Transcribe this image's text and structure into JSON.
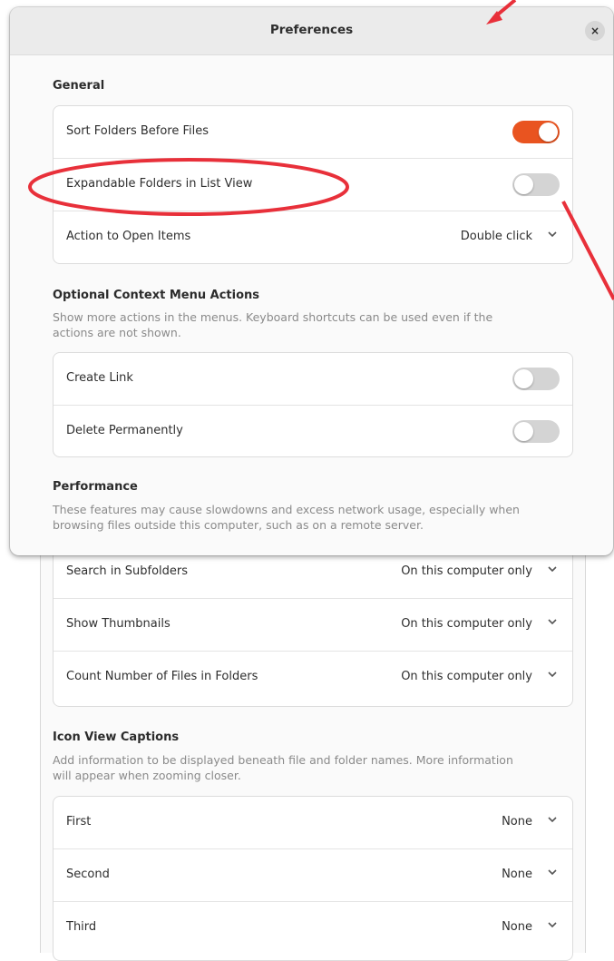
{
  "dialog": {
    "title": "Preferences",
    "close_glyph": "×"
  },
  "general": {
    "title": "General",
    "rows": [
      {
        "label": "Sort Folders Before Files",
        "toggle": true
      },
      {
        "label": "Expandable Folders in List View",
        "toggle": false
      },
      {
        "label": "Action to Open Items",
        "value": "Double click"
      }
    ]
  },
  "context_menu": {
    "title": "Optional Context Menu Actions",
    "description_line1": "Show more actions in the menus. Keyboard shortcuts can be used even if the",
    "description_line2": "actions are not shown.",
    "rows": [
      {
        "label": "Create Link",
        "toggle": false
      },
      {
        "label": "Delete Permanently",
        "toggle": false
      }
    ]
  },
  "performance": {
    "title": "Performance",
    "description_line1": "These features may cause slowdowns and excess network usage, especially when",
    "description_line2": "browsing files outside this computer, such as on a remote server.",
    "rows": [
      {
        "label": "Search in Subfolders",
        "value": "On this computer only"
      },
      {
        "label": "Show Thumbnails",
        "value": "On this computer only"
      },
      {
        "label": "Count Number of Files in Folders",
        "value": "On this computer only"
      }
    ]
  },
  "icon_captions": {
    "title": "Icon View Captions",
    "description_line1": "Add information to be displayed beneath file and folder names. More information",
    "description_line2": "will appear when zooming closer.",
    "rows": [
      {
        "label": "First",
        "value": "None"
      },
      {
        "label": "Second",
        "value": "None"
      },
      {
        "label": "Third",
        "value": "None"
      }
    ]
  },
  "icons": {
    "dropdown": "chevron-down-icon",
    "close": "close-icon"
  },
  "colors": {
    "accent": "#e95420",
    "annotation": "#e8303a"
  }
}
